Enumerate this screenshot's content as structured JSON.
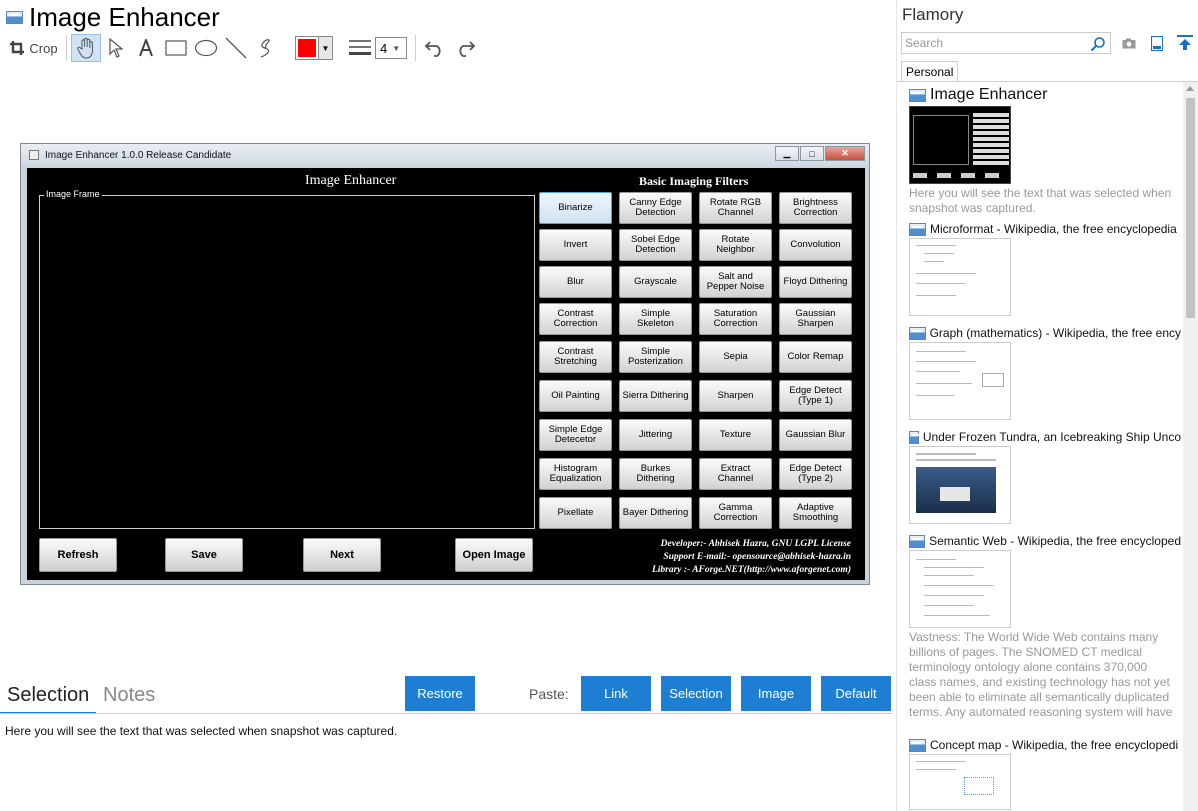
{
  "app": {
    "title": "Image Enhancer"
  },
  "toolbar": {
    "crop_label": "Crop",
    "line_width_value": "4",
    "color": "#ff0000",
    "tools": [
      "hand-icon",
      "pointer-icon",
      "text-icon",
      "rectangle-icon",
      "ellipse-icon",
      "line-icon",
      "freehand-icon",
      "line-width-icon",
      "undo-icon",
      "redo-icon"
    ]
  },
  "snapshot": {
    "window_title": "Image  Enhancer 1.0.0  Release Candidate",
    "heading": "Image Enhancer",
    "filters_heading": "Basic Imaging Filters",
    "frame_label": "Image Frame",
    "filters": [
      "Binarize",
      "Canny Edge Detection",
      "Rotate RGB Channel",
      "Brightness Correction",
      "Invert",
      "Sobel Edge Detection",
      "Rotate Neighbor",
      "Convolution",
      "Blur",
      "Grayscale",
      "Salt and Pepper Noise",
      "Floyd Dithering",
      "Contrast Correction",
      "Simple Skeleton",
      "Saturation Correction",
      "Gaussian Sharpen",
      "Contrast Stretching",
      "Simple Posterization",
      "Sepia",
      "Color Remap",
      "Oil Painting",
      "Sierra Dithering",
      "Sharpen",
      "Edge Detect (Type 1)",
      "Simple Edge Detecetor",
      "Jittering",
      "Texture",
      "Gaussian Blur",
      "Histogram Equalization",
      "Burkes Dithering",
      "Extract Channel",
      "Edge Detect (Type 2)",
      "Pixellate",
      "Bayer Dithering",
      "Gamma Correction",
      "Adaptive Smoothing"
    ],
    "buttons": {
      "refresh": "Refresh",
      "save": "Save",
      "next": "Next",
      "open": "Open Image"
    },
    "credits": [
      "Developer:- Abhisek Hazra, GNU LGPL License",
      "Support E-mail:- opensource@abhisek-hazra.in",
      "Library :- AForge.NET(http://www.aforgenet.com)"
    ]
  },
  "bottom": {
    "tabs": [
      "Selection",
      "Notes"
    ],
    "restore": "Restore",
    "paste_label": "Paste:",
    "paste_buttons": [
      "Link",
      "Selection",
      "Image",
      "Default"
    ],
    "selection_text": "Here you will see the text that was selected when snapshot was captured."
  },
  "sidebar": {
    "title": "Flamory",
    "search_placeholder": "Search",
    "tab": "Personal",
    "items": [
      {
        "title": "Image Enhancer",
        "desc": "Here you will see the text that was selected when snapshot was captured."
      },
      {
        "title": "Microformat - Wikipedia, the free encyclopedia",
        "desc": ""
      },
      {
        "title": "Graph (mathematics) - Wikipedia, the free ency",
        "desc": ""
      },
      {
        "title": "Under Frozen Tundra, an Icebreaking Ship Unco",
        "desc": ""
      },
      {
        "title": "Semantic Web - Wikipedia, the free encycloped",
        "desc": "Vastness: The World Wide Web contains many billions of pages. The SNOMED CT medical terminology ontology alone contains 370,000 class names, and existing technology has not yet been able to eliminate all semantically duplicated terms. Any automated reasoning system will have to deal with truly huge inputs."
      },
      {
        "title": "Concept map - Wikipedia, the free encyclopedi",
        "desc": ""
      }
    ]
  }
}
